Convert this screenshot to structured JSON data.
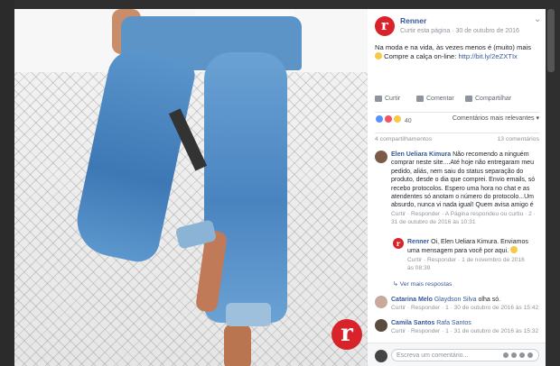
{
  "post": {
    "page_name": "Renner",
    "meta_like": "Curtir esta página",
    "meta_sep": " · ",
    "date": "30 de outubro de 2016",
    "more_icon": "⌄",
    "text": "Na moda e na vida, às vezes menos é (muito) mais",
    "text_line2": "Compre a calça on-line: ",
    "link": "http://bit.ly/2eZXTIx",
    "logo_letter": "r"
  },
  "actions": {
    "like": "Curtir",
    "comment": "Comentar",
    "share": "Compartilhar"
  },
  "reactions": {
    "count": "40",
    "colors": [
      "#5890ff",
      "#f25268",
      "#f7c948"
    ],
    "sort_label": "Comentários mais relevantes ▾"
  },
  "counts": {
    "shares": "4 compartilhamentos",
    "comments": "13 comentários"
  },
  "comments": [
    {
      "name": "Elen Ueliara Kimura",
      "text": "Não recomendo a ninguém comprar neste site....Até hoje não entregaram meu pedido, aliás, nem saiu do status separação do produto, desde o dia que comprei. Envio emails, só recebo protocolos. Espero uma hora no chat e as atendentes só anotam o número do protocolo...Um absurdo, nunca vi nada igual! Quem avisa amigo é",
      "meta": "Curtir · Responder · A Página respondeu ou curtiu · ",
      "meta2": "2 · 31 de outubro de 2016 às 10:31"
    },
    {
      "name": "Catarina Melo",
      "tag": "Glaydson Silva",
      "text": "olha só.",
      "meta": "Curtir · Responder · ",
      "meta2": "1 · 30 de outubro de 2016 às 15:42"
    },
    {
      "name": "Camila Santos",
      "tag": "Rafa Santos",
      "text": "",
      "meta": "Curtir · Responder · ",
      "meta2": "1 · 31 de outubro de 2016 às 15:32"
    }
  ],
  "reply": {
    "name": "Renner",
    "text": "Oi, Elen Ueliara Kimura. Enviamos uma mensagem para você por aqui. ",
    "meta": "Curtir · Responder · ",
    "meta2": "1 de novembro de 2016 às 08:39",
    "logo_letter": "r"
  },
  "more_replies": "↳ Ver mais respostas",
  "composer": {
    "placeholder": "Escreva um comentário..."
  }
}
